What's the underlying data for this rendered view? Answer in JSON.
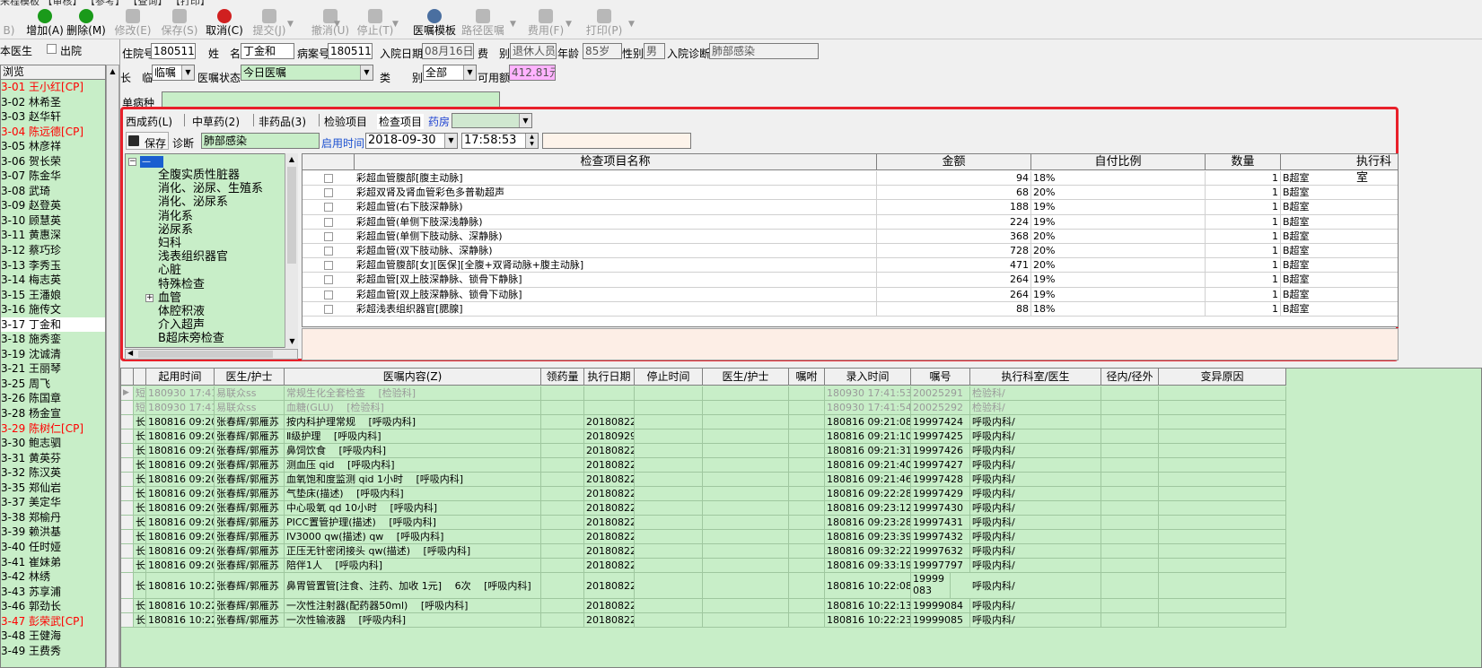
{
  "toolbar": {
    "top_cut": "来程模板  【审核】  【参考】  【查询】  【打印】",
    "buttons": [
      {
        "label": "B)",
        "disabled": true
      },
      {
        "label": "增加(A)",
        "disabled": false,
        "color": "#1a9a1a"
      },
      {
        "label": "删除(M)",
        "disabled": false,
        "color": "#1a9a1a"
      },
      {
        "label": "修改(E)",
        "disabled": true
      },
      {
        "label": "保存(S)",
        "disabled": true
      },
      {
        "label": "取消(C)",
        "disabled": false,
        "color": "#d02020"
      },
      {
        "label": "提交(J)",
        "disabled": true
      },
      {
        "label": "撤消(U)",
        "disabled": true
      },
      {
        "label": "停止(T)",
        "disabled": true
      },
      {
        "label": "医嘱模板",
        "disabled": false,
        "color": "#4a6fa0"
      },
      {
        "label": "路径医嘱",
        "disabled": true
      },
      {
        "label": "费用(F)",
        "disabled": true
      },
      {
        "label": "打印(P)",
        "disabled": true
      }
    ]
  },
  "left": {
    "doctor_label": "本医生",
    "discharge_label": "出院",
    "list_header": "浏览",
    "patients": [
      {
        "text": "3-01 王小红[CP]",
        "red": true
      },
      {
        "text": "3-02 林希圣",
        "red": false
      },
      {
        "text": "3-03 赵华轩",
        "red": false
      },
      {
        "text": "3-04 陈远德[CP]",
        "red": true
      },
      {
        "text": "3-05 林彦祥",
        "red": false
      },
      {
        "text": "3-06 贺长荣",
        "red": false
      },
      {
        "text": "3-07 陈金华",
        "red": false
      },
      {
        "text": "3-08 武琦",
        "red": false
      },
      {
        "text": "3-09 赵登英",
        "red": false
      },
      {
        "text": "3-10 顾慧英",
        "red": false
      },
      {
        "text": "3-11 黄惠深",
        "red": false
      },
      {
        "text": "3-12 蔡巧珍",
        "red": false
      },
      {
        "text": "3-13 李秀玉",
        "red": false
      },
      {
        "text": "3-14 梅志英",
        "red": false
      },
      {
        "text": "3-15 王潘娘",
        "red": false
      },
      {
        "text": "3-16 施传文",
        "red": false
      },
      {
        "text": "3-17 丁金和",
        "red": false,
        "selected": true
      },
      {
        "text": "3-18 施秀銮",
        "red": false
      },
      {
        "text": "3-19 沈诚清",
        "red": false
      },
      {
        "text": "3-21 王丽琴",
        "red": false
      },
      {
        "text": "3-25 周飞",
        "red": false
      },
      {
        "text": "3-26 陈国章",
        "red": false
      },
      {
        "text": "3-28 杨金宣",
        "red": false
      },
      {
        "text": "3-29 陈树仁[CP]",
        "red": true
      },
      {
        "text": "3-30 鲍志驷",
        "red": false
      },
      {
        "text": "3-31 黄英芬",
        "red": false
      },
      {
        "text": "3-32 陈汉英",
        "red": false
      },
      {
        "text": "3-35 郑仙岩",
        "red": false
      },
      {
        "text": "3-37 美定华",
        "red": false
      },
      {
        "text": "3-38 郑榆丹",
        "red": false
      },
      {
        "text": "3-39 赖洪基",
        "red": false
      },
      {
        "text": "3-40 任时娅",
        "red": false
      },
      {
        "text": "3-41 崔妹弟",
        "red": false
      },
      {
        "text": "3-42 林绣",
        "red": false
      },
      {
        "text": "3-43 苏享浦",
        "red": false
      },
      {
        "text": "3-46 郭劲长",
        "red": false
      },
      {
        "text": "3-47 彭荣武[CP]",
        "red": true
      },
      {
        "text": "3-48 王健海",
        "red": false
      },
      {
        "text": "3-49 王费秀",
        "red": false
      }
    ]
  },
  "form": {
    "hosp_no_label": "住院号",
    "hosp_no": "1805111",
    "name_label": "姓　名",
    "name": "丁金和",
    "case_no_label": "病案号",
    "case_no": "1805111",
    "adm_date_label": "入院日期",
    "adm_date": "08月16日",
    "fee_type_label": "费　别",
    "fee_type": "退休人员",
    "age_label": "年龄",
    "age": "85岁",
    "sex_label": "性别",
    "sex": "男",
    "diag_label": "入院诊断",
    "diag": "肺部感染",
    "long_label": "长　临",
    "long_value": "临嘱",
    "status_label": "医嘱状态",
    "status_value": "今日医嘱",
    "category_label": "类　　别",
    "category_value": "全部",
    "balance_label": "可用额",
    "balance_value": "412.81元",
    "disease_label": "单病种"
  },
  "tabs": {
    "items": [
      "西成药(L)",
      "中草药(2)",
      "非药品(3)",
      "检验项目",
      "检查项目",
      "药房"
    ],
    "save_label": "保存",
    "diag_label": "诊断",
    "diag_value": "肺部感染",
    "start_label": "启用时间",
    "date_value": "2018-09-30",
    "time_value": "17:58:53"
  },
  "tree": {
    "root": "—",
    "nodes": [
      "全腹实质性脏器",
      "消化、泌尿、生殖系",
      "消化、泌尿系",
      "消化系",
      "泌尿系",
      "妇科",
      "浅表组织器官",
      "心脏",
      "特殊检查",
      "血管",
      "体腔积液",
      "介入超声",
      "B超床旁检查"
    ]
  },
  "exam_grid": {
    "headers": [
      "检查项目名称",
      "金额",
      "自付比例",
      "数量",
      "执行科室"
    ],
    "rows": [
      {
        "name": "彩超血管腹部[腹主动脉]",
        "amount": "94",
        "ratio": "18%",
        "qty": "1",
        "dept": "B超室"
      },
      {
        "name": "彩超双肾及肾血管彩色多普勒超声",
        "amount": "68",
        "ratio": "20%",
        "qty": "1",
        "dept": "B超室"
      },
      {
        "name": "彩超血管(右下肢深静脉)",
        "amount": "188",
        "ratio": "19%",
        "qty": "1",
        "dept": "B超室"
      },
      {
        "name": "彩超血管(单侧下肢深浅静脉)",
        "amount": "224",
        "ratio": "19%",
        "qty": "1",
        "dept": "B超室"
      },
      {
        "name": "彩超血管(单侧下肢动脉、深静脉)",
        "amount": "368",
        "ratio": "20%",
        "qty": "1",
        "dept": "B超室"
      },
      {
        "name": "彩超血管(双下肢动脉、深静脉)",
        "amount": "728",
        "ratio": "20%",
        "qty": "1",
        "dept": "B超室"
      },
      {
        "name": "彩超血管腹部[女][医保][全腹+双肾动脉+腹主动脉]",
        "amount": "471",
        "ratio": "20%",
        "qty": "1",
        "dept": "B超室"
      },
      {
        "name": "彩超血管[双上肢深静脉、锁骨下静脉]",
        "amount": "264",
        "ratio": "19%",
        "qty": "1",
        "dept": "B超室"
      },
      {
        "name": "彩超血管[双上肢深静脉、锁骨下动脉]",
        "amount": "264",
        "ratio": "19%",
        "qty": "1",
        "dept": "B超室"
      },
      {
        "name": "彩超浅表组织器官[腮腺]",
        "amount": "88",
        "ratio": "18%",
        "qty": "1",
        "dept": "B超室"
      }
    ]
  },
  "order_grid": {
    "headers": [
      "起用时间",
      "医生/护士",
      "医嘱内容(Z)",
      "领药量",
      "执行日期",
      "停止时间",
      "医生/护士",
      "嘱咐",
      "录入时间",
      "嘱号",
      "执行科室/医生",
      "径内/径外",
      "变异原因"
    ],
    "rows": [
      {
        "type": "短",
        "start": "180930 17:41",
        "doctor": "易联众ss",
        "content": "常规生化全套检查 　[检验科]",
        "exec": "",
        "entry": "180930 17:41:53",
        "no": "20025291",
        "dept": "检验科/",
        "faded": true,
        "current": true
      },
      {
        "type": "短",
        "start": "180930 17:41",
        "doctor": "易联众ss",
        "content": "血糖(GLU) 　[检验科]",
        "exec": "",
        "entry": "180930 17:41:54",
        "no": "20025292",
        "dept": "检验科/",
        "faded": true
      },
      {
        "type": "长",
        "start": "180816 09:20",
        "doctor": "张春辉/郭雁苏",
        "content": "按内科护理常规 　[呼吸内科]",
        "exec": "20180822",
        "entry": "180816 09:21:08",
        "no": "19997424",
        "dept": "呼吸内科/"
      },
      {
        "type": "长",
        "start": "180816 09:20",
        "doctor": "张春辉/郭雁苏",
        "content": "Ⅱ级护理 　[呼吸内科]",
        "exec": "20180929",
        "entry": "180816 09:21:10",
        "no": "19997425",
        "dept": "呼吸内科/"
      },
      {
        "type": "长",
        "start": "180816 09:20",
        "doctor": "张春辉/郭雁苏",
        "content": "鼻饲饮食 　[呼吸内科]",
        "exec": "20180822",
        "entry": "180816 09:21:31",
        "no": "19997426",
        "dept": "呼吸内科/"
      },
      {
        "type": "长",
        "start": "180816 09:20",
        "doctor": "张春辉/郭雁苏",
        "content": "测血压 qid 　[呼吸内科]",
        "exec": "20180822",
        "entry": "180816 09:21:40",
        "no": "19997427",
        "dept": "呼吸内科/"
      },
      {
        "type": "长",
        "start": "180816 09:20",
        "doctor": "张春辉/郭雁苏",
        "content": "血氧饱和度监测 qid 1小时 　[呼吸内科]",
        "exec": "20180822",
        "entry": "180816 09:21:46",
        "no": "19997428",
        "dept": "呼吸内科/"
      },
      {
        "type": "长",
        "start": "180816 09:20",
        "doctor": "张春辉/郭雁苏",
        "content": "气垫床(描述) 　[呼吸内科]",
        "exec": "20180822",
        "entry": "180816 09:22:28",
        "no": "19997429",
        "dept": "呼吸内科/"
      },
      {
        "type": "长",
        "start": "180816 09:20",
        "doctor": "张春辉/郭雁苏",
        "content": "中心吸氧 qd 10小时 　[呼吸内科]",
        "exec": "20180822",
        "entry": "180816 09:23:12",
        "no": "19997430",
        "dept": "呼吸内科/"
      },
      {
        "type": "长",
        "start": "180816 09:20",
        "doctor": "张春辉/郭雁苏",
        "content": "PICC置管护理(描述) 　[呼吸内科]",
        "exec": "20180822",
        "entry": "180816 09:23:28",
        "no": "19997431",
        "dept": "呼吸内科/"
      },
      {
        "type": "长",
        "start": "180816 09:20",
        "doctor": "张春辉/郭雁苏",
        "content": "IV3000 qw(描述) qw 　[呼吸内科]",
        "exec": "20180822",
        "entry": "180816 09:23:39",
        "no": "19997432",
        "dept": "呼吸内科/"
      },
      {
        "type": "长",
        "start": "180816 09:20",
        "doctor": "张春辉/郭雁苏",
        "content": "正压无针密闭接头 qw(描述) 　[呼吸内科]",
        "exec": "20180822",
        "entry": "180816 09:32:22",
        "no": "19997632",
        "dept": "呼吸内科/"
      },
      {
        "type": "长",
        "start": "180816 09:20",
        "doctor": "张春辉/郭雁苏",
        "content": "陪伴1人 　[呼吸内科]",
        "exec": "20180822",
        "entry": "180816 09:33:19",
        "no": "19997797",
        "dept": "呼吸内科/"
      },
      {
        "type": "长",
        "start": "180816 10:22",
        "doctor": "张春辉/郭雁苏",
        "content": "鼻胃管置管[注食、注药、加收 1元] 　6次 　[呼吸内科]",
        "exec": "20180822",
        "entry": "180816 10:22:08",
        "no": "19999083",
        "dept": "呼吸内科/",
        "tall": true
      },
      {
        "type": "长",
        "start": "180816 10:22",
        "doctor": "张春辉/郭雁苏",
        "content": "一次性注射器(配药器50ml) 　[呼吸内科]",
        "exec": "20180822",
        "entry": "180816 10:22:13",
        "no": "19999084",
        "dept": "呼吸内科/"
      },
      {
        "type": "长",
        "start": "180816 10:22",
        "doctor": "张春辉/郭雁苏",
        "content": "一次性输液器 　[呼吸内科]",
        "exec": "20180822",
        "entry": "180816 10:22:23",
        "no": "19999085",
        "dept": "呼吸内科/"
      }
    ]
  }
}
